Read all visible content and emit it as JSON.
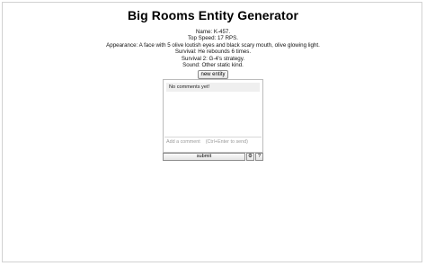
{
  "page": {
    "title": "Big Rooms Entity Generator"
  },
  "entity": {
    "name": "Name: K-457.",
    "top_speed": "Top Speed: 17 RPS.",
    "appearance": "Appearance: A face with 5 olive loutish eyes and black scary mouth, olive glowing light.",
    "survival": "Survival: He rebounds 6 times.",
    "survival2": "Survival 2: G-4's strategy.",
    "sound": "Sound: Other static kind."
  },
  "controls": {
    "new_entity_label": "new entity"
  },
  "comments": {
    "empty_text": "No comments yet!",
    "placeholder": "Add a comment    (Ctrl+Enter to send)",
    "submit_label": "submit",
    "settings_icon": "gear-icon",
    "help_label": "?"
  }
}
